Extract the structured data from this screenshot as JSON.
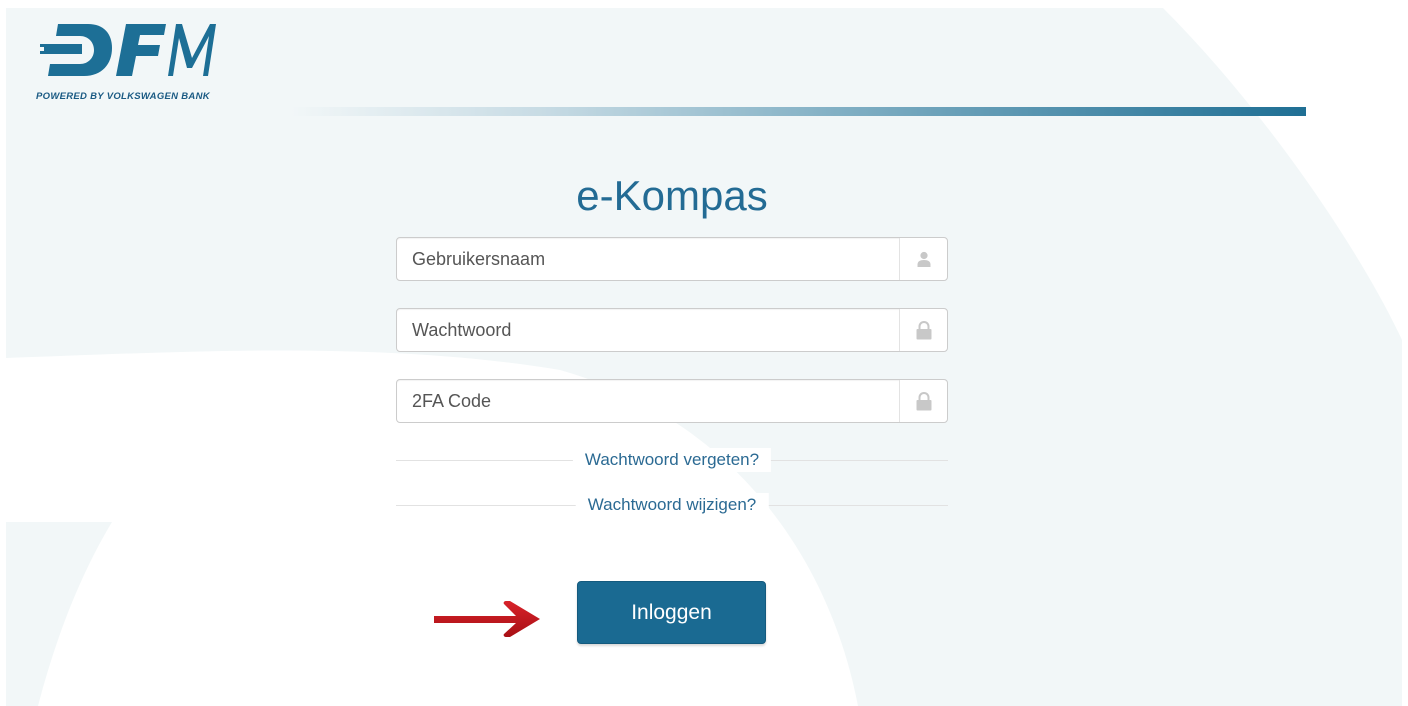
{
  "logo": {
    "brand": "DFM",
    "tagline": "POWERED BY VOLKSWAGEN BANK"
  },
  "login": {
    "title": "e-Kompas",
    "username_placeholder": "Gebruikersnaam",
    "password_placeholder": "Wachtwoord",
    "twofa_placeholder": "2FA Code",
    "forgot_password_link": "Wachtwoord vergeten?",
    "change_password_link": "Wachtwoord wijzigen?",
    "submit_label": "Inloggen"
  },
  "icons": {
    "username": "user-icon",
    "password": "lock-icon",
    "twofa": "lock-icon",
    "annotation": "red-arrow-icon"
  },
  "colors": {
    "brand": "#1a6a92",
    "title": "#236b94",
    "link": "#2b6a93",
    "background_tint": "#f2f7f8",
    "annotation_arrow": "#c0141b"
  }
}
